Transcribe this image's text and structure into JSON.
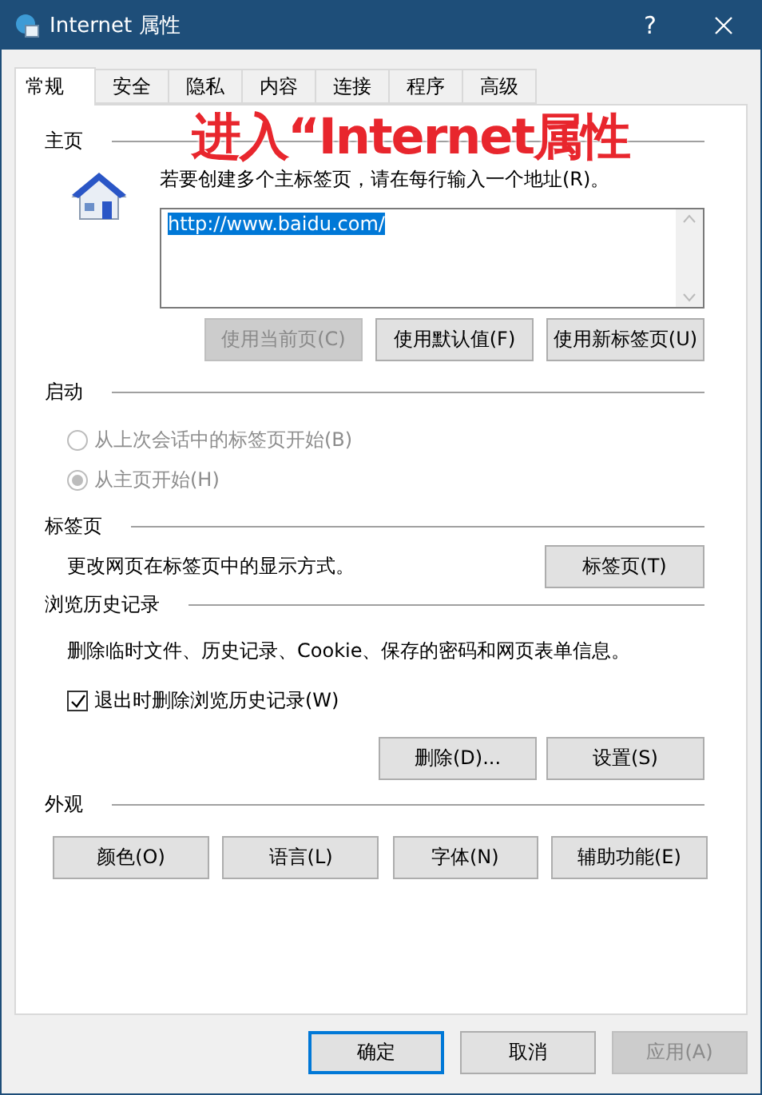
{
  "window": {
    "title": "Internet 属性",
    "help": "?"
  },
  "tabs": [
    {
      "label": "常规",
      "selected": true
    },
    {
      "label": "安全",
      "selected": false
    },
    {
      "label": "隐私",
      "selected": false
    },
    {
      "label": "内容",
      "selected": false
    },
    {
      "label": "连接",
      "selected": false
    },
    {
      "label": "程序",
      "selected": false
    },
    {
      "label": "高级",
      "selected": false
    }
  ],
  "annotation": "进入“Internet属性",
  "home_page": {
    "heading": "主页",
    "instruction": "若要创建多个主标签页，请在每行输入一个地址(R)。",
    "addresses": "http://www.baidu.com/",
    "text_selected": true,
    "buttons": [
      {
        "label": "使用当前页(C)",
        "disabled": true
      },
      {
        "label": "使用默认值(F)",
        "disabled": false
      },
      {
        "label": "使用新标签页(U)",
        "disabled": false
      }
    ]
  },
  "startup": {
    "heading": "启动",
    "options": [
      {
        "label": "从上次会话中的标签页开始(B)",
        "selected": false,
        "disabled": true
      },
      {
        "label": "从主页开始(H)",
        "selected": true,
        "disabled": true
      }
    ]
  },
  "tabs_section": {
    "heading": "标签页",
    "description": "更改网页在标签页中的显示方式。",
    "button": {
      "label": "标签页(T)",
      "disabled": false
    }
  },
  "history": {
    "heading": "浏览历史记录",
    "description": "删除临时文件、历史记录、Cookie、保存的密码和网页表单信息。",
    "checkbox": {
      "label": "退出时删除浏览历史记录(W)",
      "checked": true
    },
    "buttons": [
      {
        "label": "删除(D)...",
        "disabled": false
      },
      {
        "label": "设置(S)",
        "disabled": false
      }
    ]
  },
  "appearance": {
    "heading": "外观",
    "buttons": [
      {
        "label": "颜色(O)",
        "disabled": false
      },
      {
        "label": "语言(L)",
        "disabled": false
      },
      {
        "label": "字体(N)",
        "disabled": false
      },
      {
        "label": "辅助功能(E)",
        "disabled": false
      }
    ]
  },
  "footer": [
    {
      "label": "确定",
      "focused": true,
      "disabled": false
    },
    {
      "label": "取消",
      "focused": false,
      "disabled": false
    },
    {
      "label": "应用(A)",
      "focused": false,
      "disabled": true
    }
  ]
}
